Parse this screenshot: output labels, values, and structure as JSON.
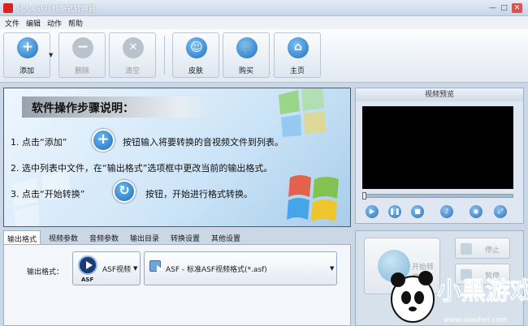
{
  "window": {
    "title": "凡人ASF视频格式转换器"
  },
  "menu": [
    "文件",
    "编辑",
    "动作",
    "帮助"
  ],
  "toolbar": {
    "add": "添加",
    "delete": "删除",
    "clear": "清空",
    "skin": "皮肤",
    "buy": "购买",
    "home": "主页"
  },
  "banner": {
    "title": "软件操作步骤说明：",
    "step1_a": "1. 点击“添加”",
    "step1_b": "按钮输入将要转换的音视频文件到列表。",
    "step2": "2. 选中列表中文件，在“输出格式”选项框中更改当前的输出格式。",
    "step3_a": "3. 点击“开始转换”",
    "step3_b": "按钮，开始进行格式转换。"
  },
  "tabs": [
    "输出格式",
    "视频参数",
    "音频参数",
    "输出目录",
    "转换设置",
    "其他设置"
  ],
  "output": {
    "label": "输出格式：",
    "format": "ASF视频",
    "format_icon_label": "ASF",
    "profile": "ASF - 标准ASF视频格式(*.asf)"
  },
  "preview": {
    "title": "视频预览",
    "seek_position": 0
  },
  "actions": {
    "start": "开始转换",
    "stop": "停止",
    "pause": "暂停"
  },
  "watermark": {
    "name": "小黑游戏",
    "url": "www.xiaohei.com"
  },
  "colors": {
    "accent": "#2c7bd0",
    "frame": "#c9d7e6"
  }
}
